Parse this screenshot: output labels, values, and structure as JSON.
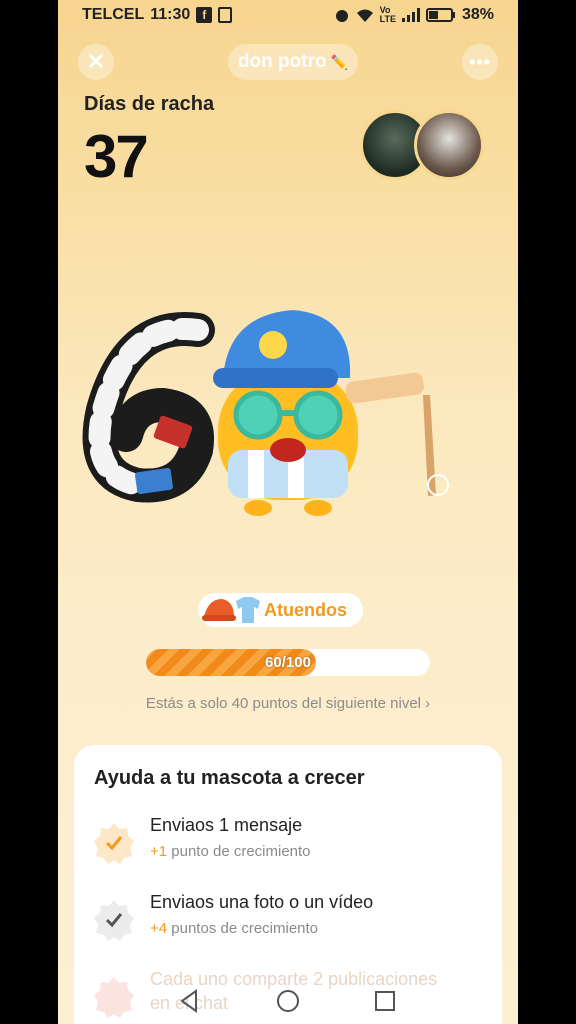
{
  "status_bar": {
    "carrier": "TELCEL",
    "time": "11:30",
    "battery": "38%",
    "icons": [
      "facebook-icon",
      "sim-icon",
      "alarm-icon",
      "wifi-icon",
      "volte-icon",
      "signal-icon",
      "battery-icon"
    ]
  },
  "header": {
    "title": "don potro",
    "title_emoji": "✏️"
  },
  "streak": {
    "label": "Días de racha",
    "value": "37"
  },
  "outfits_label": "Atuendos",
  "progress": {
    "text": "60/100",
    "fraction": 0.6
  },
  "progress_hint": "Estás a solo 40 puntos del siguiente nivel",
  "tasks_card": {
    "title": "Ayuda a tu mascota a crecer",
    "tasks": [
      {
        "title": "Enviaos 1 mensaje",
        "plus": "+1",
        "sub": "punto de crecimiento"
      },
      {
        "title": "Enviaos una foto o un vídeo",
        "plus": "+4",
        "sub": "puntos de crecimiento"
      },
      {
        "title": "Cada uno comparte 2 publicaciones",
        "sub": "en el chat"
      }
    ]
  },
  "colors": {
    "accent": "#f29a1c",
    "background_top": "#f6d58f",
    "background_bottom": "#fcefd3"
  }
}
